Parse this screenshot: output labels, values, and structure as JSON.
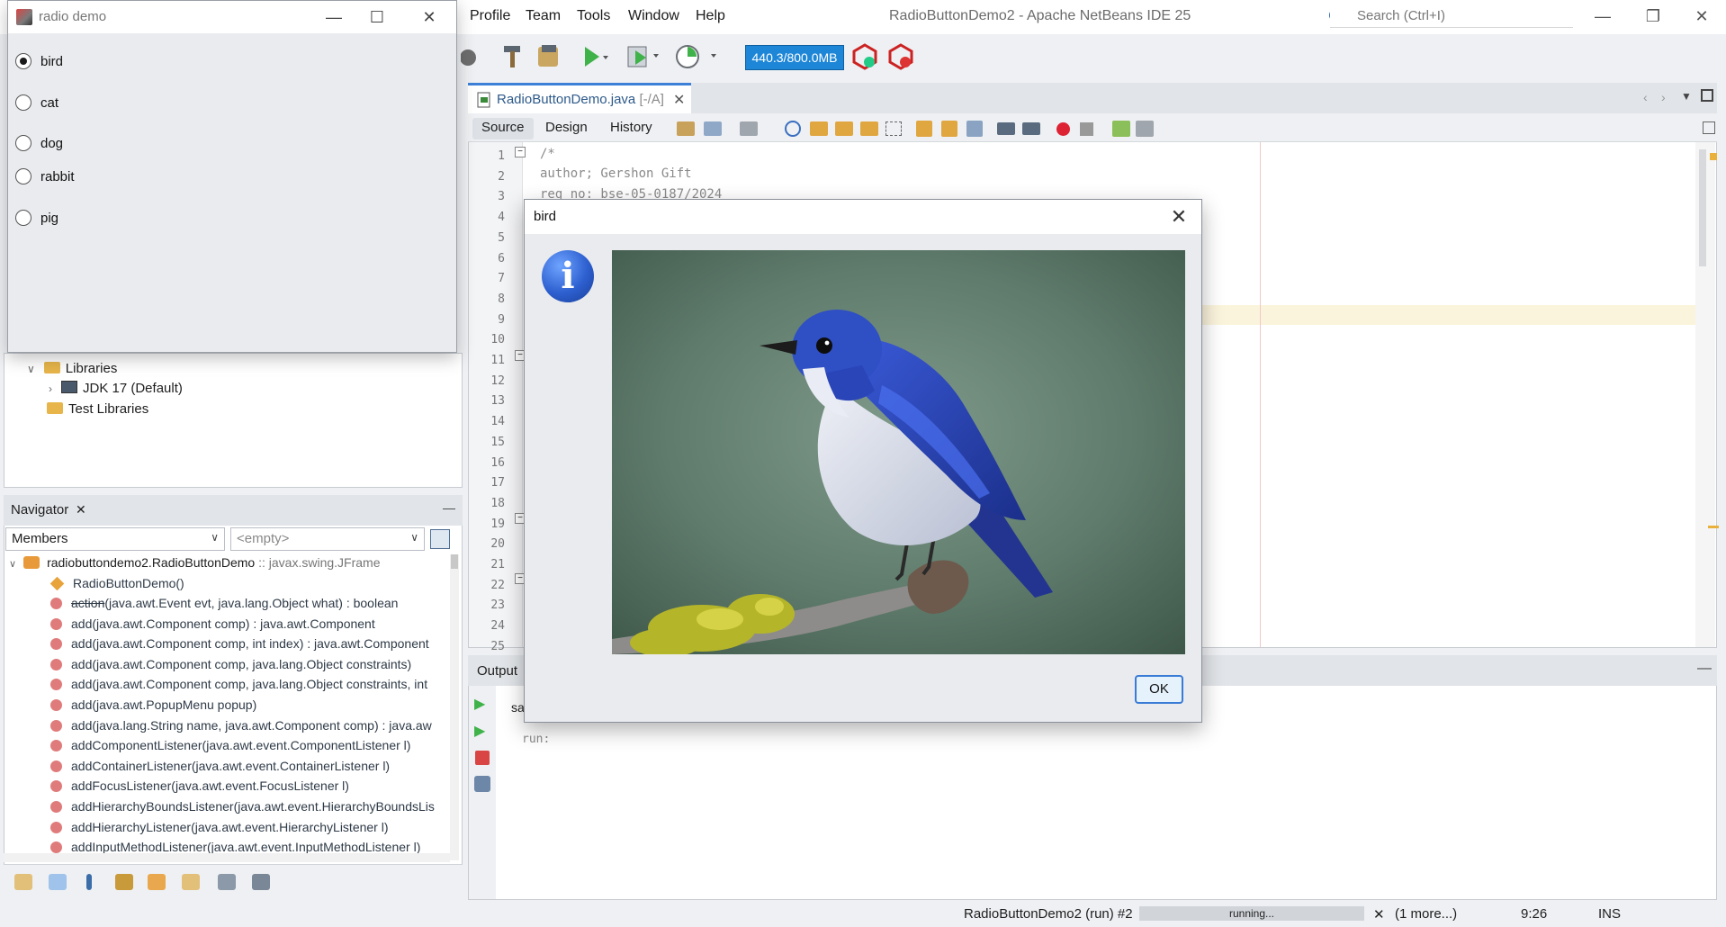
{
  "ide": {
    "title": "RadioButtonDemo2 - Apache NetBeans IDE 25",
    "menu": [
      "Profile",
      "Team",
      "Tools",
      "Window",
      "Help"
    ],
    "search_placeholder": "Search (Ctrl+I)",
    "memory": "440.3/800.0MB"
  },
  "editor": {
    "tab_label": "RadioButtonDemo.java",
    "tab_sub": "[-/A]",
    "view_tabs": [
      "Source",
      "Design",
      "History"
    ],
    "active_view": "Source",
    "line_numbers": [
      "1",
      "2",
      "3",
      "4",
      "5",
      "6",
      "7",
      "8",
      "9",
      "10",
      "11",
      "12",
      "13",
      "14",
      "15",
      "16",
      "17",
      "18",
      "19",
      "20",
      "21",
      "22",
      "23",
      "24",
      "25"
    ],
    "code_lines": [
      "/*",
      "author; Gershon Gift",
      "reg no: bse-05-0187/2024"
    ]
  },
  "output": {
    "title": "Output",
    "tab_prefix": "sa",
    "run_text": "run:"
  },
  "projects": {
    "items": [
      {
        "label": "Libraries",
        "type": "folder"
      },
      {
        "label": "JDK 17 (Default)",
        "type": "jdk"
      },
      {
        "label": "Test Libraries",
        "type": "folder"
      }
    ]
  },
  "navigator": {
    "title": "Navigator",
    "filter_value": "Members",
    "filter2_value": "<empty>",
    "root": "radiobuttondemo2.RadioButtonDemo",
    "root_type": ":: javax.swing.JFrame",
    "constructor": "RadioButtonDemo()",
    "members": [
      {
        "name": "action",
        "sig": "(java.awt.Event evt, java.lang.Object what) : boolean",
        "deprecated": true
      },
      {
        "name": "add",
        "sig": "(java.awt.Component comp) : java.awt.Component"
      },
      {
        "name": "add",
        "sig": "(java.awt.Component comp, int index) : java.awt.Component"
      },
      {
        "name": "add",
        "sig": "(java.awt.Component comp, java.lang.Object constraints)"
      },
      {
        "name": "add",
        "sig": "(java.awt.Component comp, java.lang.Object constraints, int"
      },
      {
        "name": "add",
        "sig": "(java.awt.PopupMenu popup)"
      },
      {
        "name": "add",
        "sig": "(java.lang.String name, java.awt.Component comp) : java.aw"
      },
      {
        "name": "addComponentListener",
        "sig": "(java.awt.event.ComponentListener l)"
      },
      {
        "name": "addContainerListener",
        "sig": "(java.awt.event.ContainerListener l)"
      },
      {
        "name": "addFocusListener",
        "sig": "(java.awt.event.FocusListener l)"
      },
      {
        "name": "addHierarchyBoundsListener",
        "sig": "(java.awt.event.HierarchyBoundsLis"
      },
      {
        "name": "addHierarchyListener",
        "sig": "(java.awt.event.HierarchyListener l)"
      },
      {
        "name": "addInputMethodListener",
        "sig": "(java.awt.event.InputMethodListener l)"
      }
    ]
  },
  "status": {
    "task": "RadioButtonDemo2 (run) #2",
    "progress_label": "running...",
    "more": "(1 more...)",
    "position": "9:26",
    "mode": "INS"
  },
  "radio_window": {
    "title": "radio demo",
    "options": [
      "bird",
      "cat",
      "dog",
      "rabbit",
      "pig"
    ],
    "selected": "bird"
  },
  "dialog": {
    "title": "bird",
    "ok_label": "OK",
    "icon": "information-icon",
    "image": "photo of a blue bird (flycatcher) perched on a mossy branch"
  },
  "colors": {
    "accent": "#3d80d8",
    "memory_bar": "#1e86d6",
    "bird_blue": "#2f4fc4"
  }
}
